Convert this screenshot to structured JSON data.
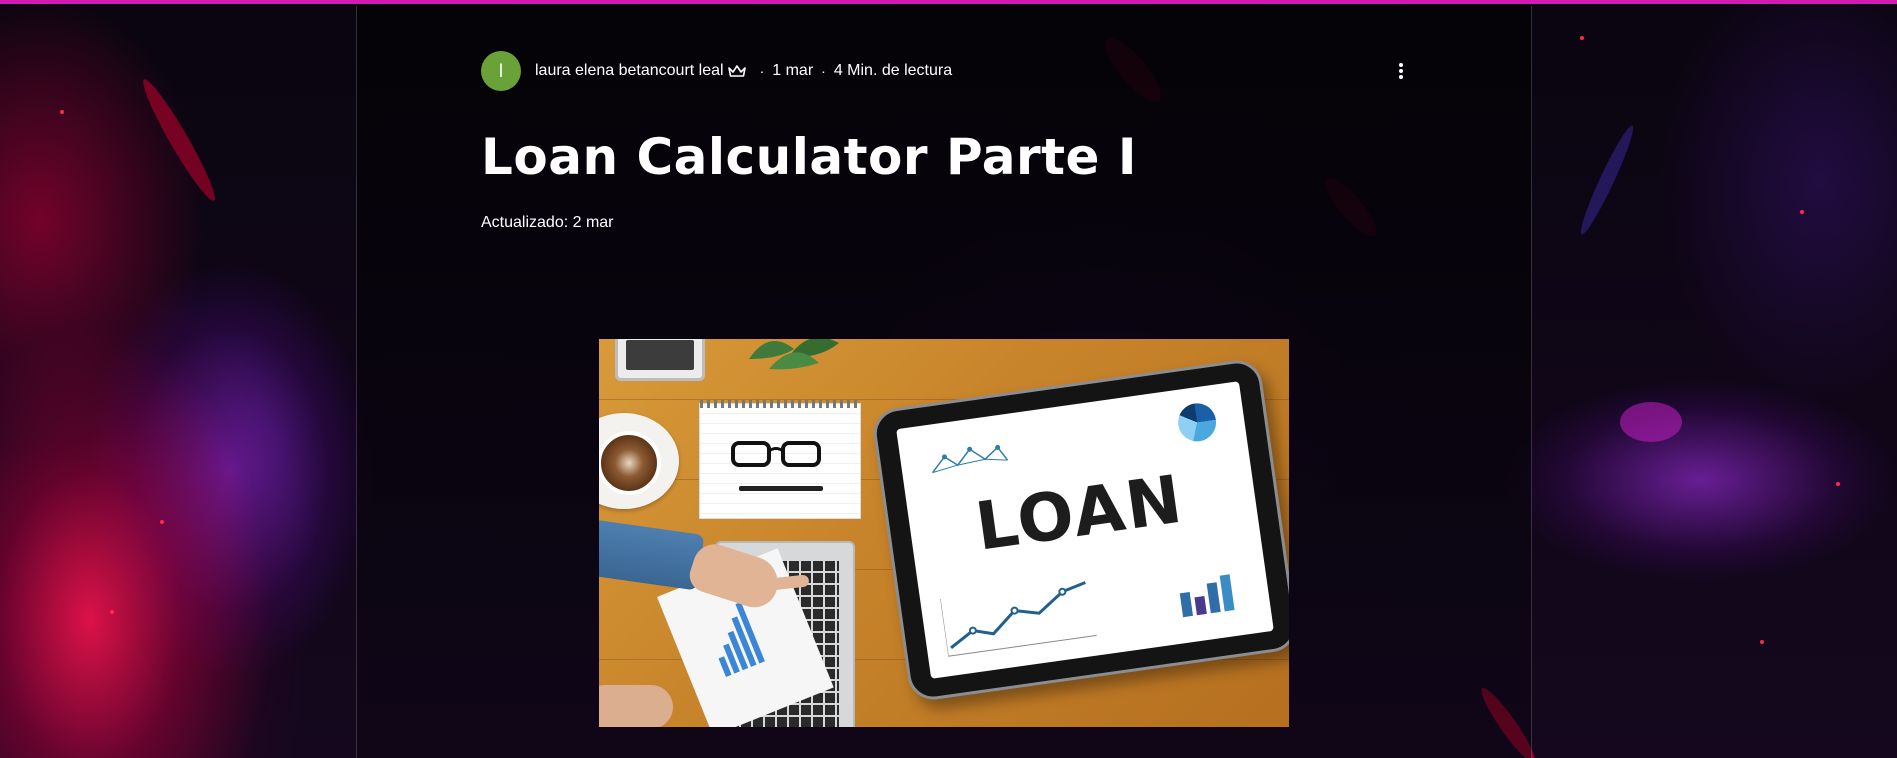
{
  "post": {
    "author_initial": "l",
    "author_name": "laura elena betancourt leal",
    "separator": "·",
    "date": "1 mar",
    "read_time": "4 Min. de lectura",
    "title": "Loan Calculator Parte I",
    "updated": "Actualizado: 2 mar"
  },
  "hero_image": {
    "word": "LOAN"
  },
  "icons": {
    "author_badge": "crown-icon",
    "post_menu": "more-vertical-icon"
  },
  "colors": {
    "accent_line": "#d21bb3",
    "avatar_bg": "#6aa23a",
    "text": "#ffffff"
  }
}
